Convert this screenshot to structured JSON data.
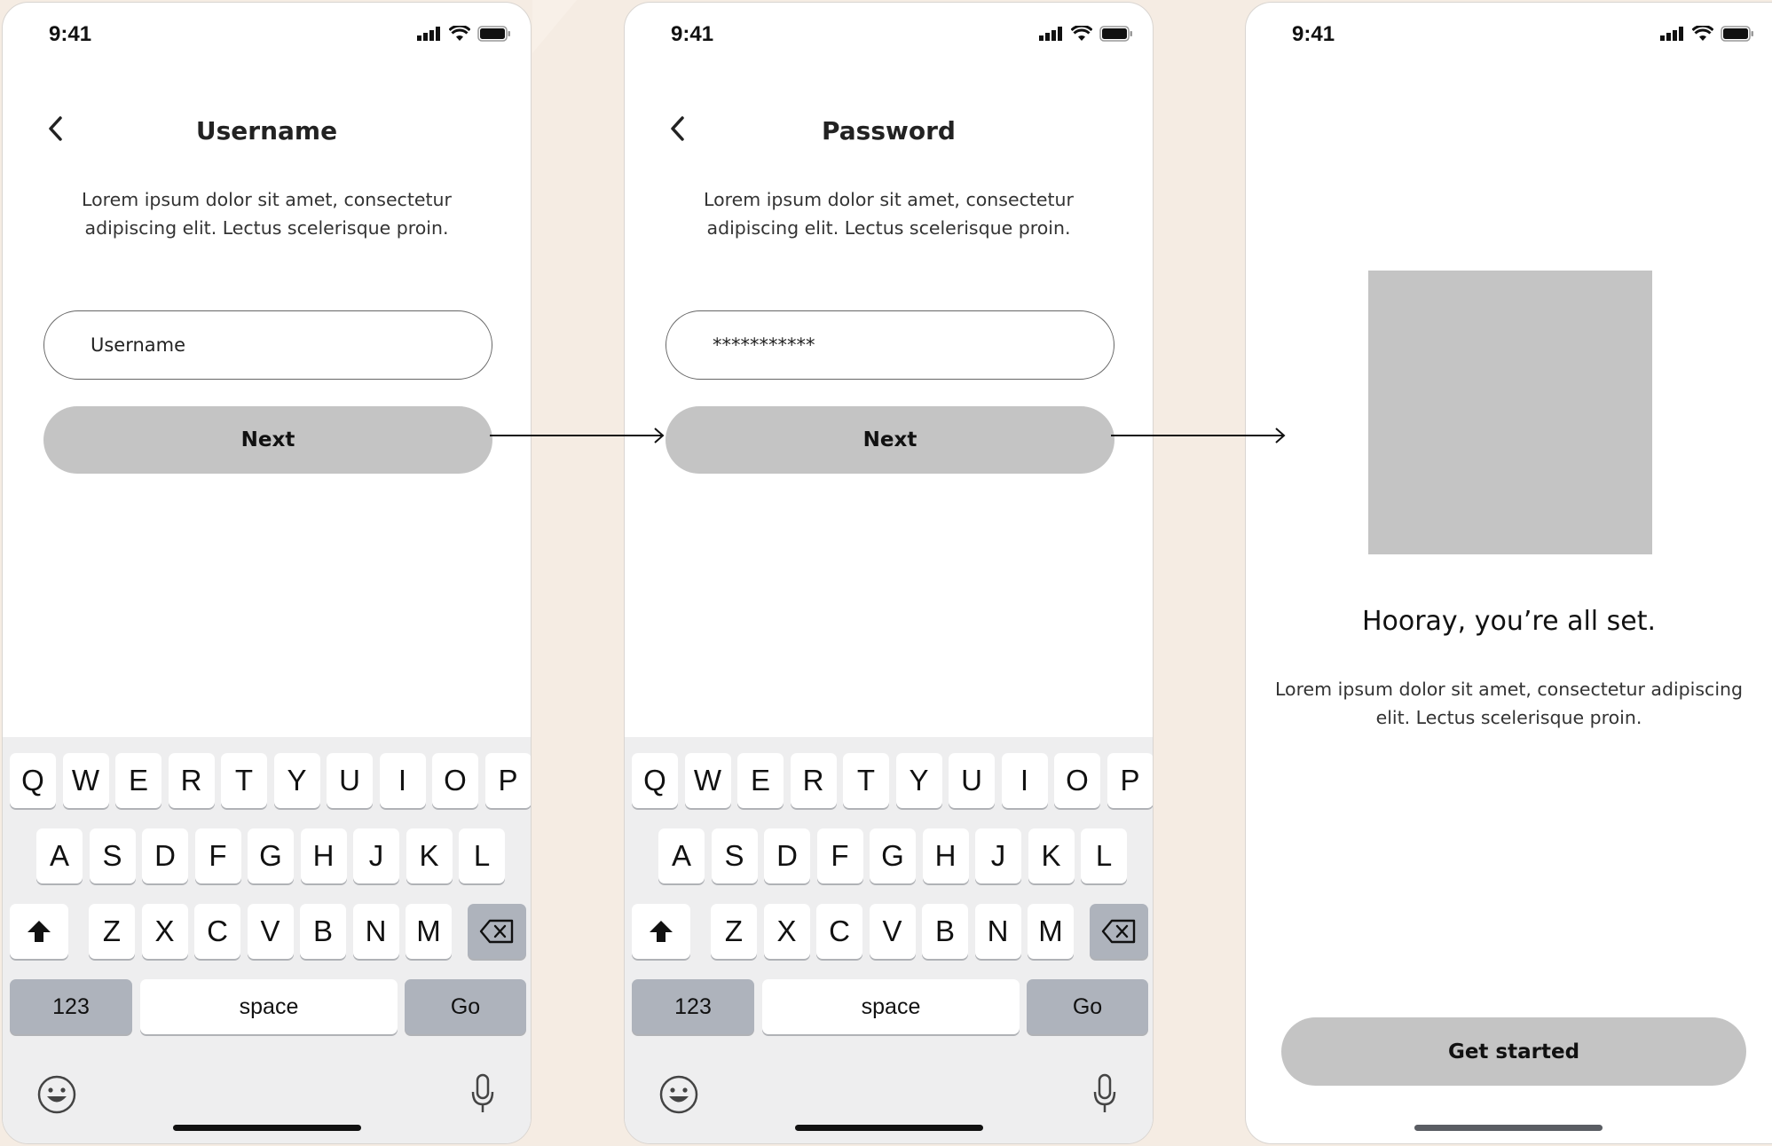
{
  "screens": [
    {
      "status_time": "9:41",
      "title": "Username",
      "description": "Lorem ipsum dolor sit amet, consectetur adipiscing elit. Lectus scelerisque proin.",
      "input_value": "Username",
      "button_label": "Next"
    },
    {
      "status_time": "9:41",
      "title": "Password",
      "description": "Lorem ipsum dolor sit amet, consectetur adipiscing elit. Lectus scelerisque proin.",
      "input_value": "***********",
      "button_label": "Next"
    },
    {
      "status_time": "9:41",
      "headline": "Hooray, you’re all set.",
      "description": "Lorem ipsum dolor sit amet, consectetur adipiscing elit. Lectus scelerisque proin.",
      "button_label": "Get started"
    }
  ],
  "keyboard": {
    "row1": [
      "Q",
      "W",
      "E",
      "R",
      "T",
      "Y",
      "U",
      "I",
      "O",
      "P"
    ],
    "row2": [
      "A",
      "S",
      "D",
      "F",
      "G",
      "H",
      "J",
      "K",
      "L"
    ],
    "row3": [
      "Z",
      "X",
      "C",
      "V",
      "B",
      "N",
      "M"
    ],
    "numbers_label": "123",
    "space_label": "space",
    "go_label": "Go"
  },
  "icons": {
    "back": "chevron-left-icon",
    "signal": "cellular-signal-icon",
    "wifi": "wifi-icon",
    "battery": "battery-icon",
    "shift": "shift-icon",
    "delete": "backspace-icon",
    "emoji": "emoji-icon",
    "mic": "microphone-icon"
  },
  "colors": {
    "button": "#c4c4c4",
    "placeholder_image": "#c4c4c4",
    "keyboard_bg": "#eeeeef",
    "dark_key": "#aeb3bc"
  }
}
